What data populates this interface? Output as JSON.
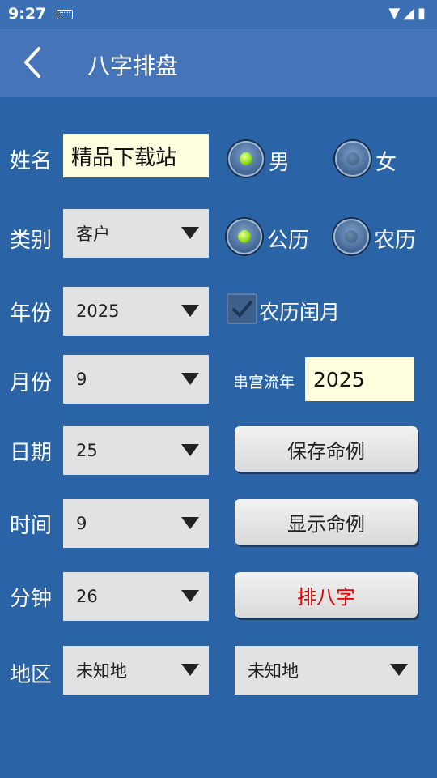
{
  "status": {
    "time": "9:27"
  },
  "header": {
    "title": "八字排盘"
  },
  "form": {
    "name": {
      "label": "姓名",
      "value": "精品下载站"
    },
    "gender": {
      "male": "男",
      "female": "女",
      "selected": "男"
    },
    "category": {
      "label": "类别",
      "value": "客户"
    },
    "calendar": {
      "solar": "公历",
      "lunar": "农历",
      "selected": "公历"
    },
    "year": {
      "label": "年份",
      "value": "2025"
    },
    "leap_month": {
      "label": "农历闰月",
      "checked": true
    },
    "month": {
      "label": "月份",
      "value": "9"
    },
    "palace_year": {
      "label": "串宫流年",
      "value": "2025"
    },
    "day": {
      "label": "日期",
      "value": "25"
    },
    "hour": {
      "label": "时间",
      "value": "9"
    },
    "minute": {
      "label": "分钟",
      "value": "26"
    },
    "region": {
      "label": "地区",
      "value1": "未知地",
      "value2": "未知地"
    }
  },
  "buttons": {
    "save": "保存命例",
    "show": "显示命例",
    "calc": "排八字"
  },
  "colors": {
    "background": "#2a64a6",
    "appbar": "#4674b9",
    "calc_text": "#e00000"
  }
}
